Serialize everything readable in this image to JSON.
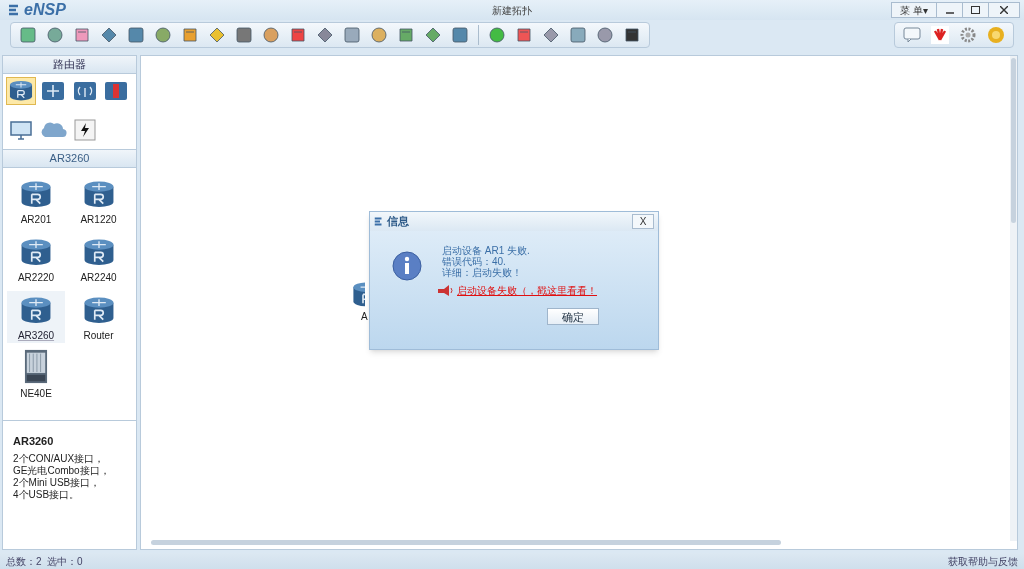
{
  "window": {
    "logo": "eNSP",
    "title": "新建拓扑",
    "menu": "菜 单▾"
  },
  "category_panel": {
    "title": "路由器",
    "categories": [
      {
        "kind": "router",
        "selected": true
      },
      {
        "kind": "switch",
        "selected": false
      },
      {
        "kind": "wireless",
        "selected": false
      },
      {
        "kind": "firewall",
        "selected": false
      },
      {
        "kind": "pc",
        "selected": false
      },
      {
        "kind": "cloud",
        "selected": false
      },
      {
        "kind": "cable",
        "selected": false
      }
    ]
  },
  "device_panel": {
    "title": "AR3260",
    "devices": [
      {
        "label": "AR201",
        "kind": "router",
        "selected": false
      },
      {
        "label": "AR1220",
        "kind": "router",
        "selected": false
      },
      {
        "label": "AR2220",
        "kind": "router",
        "selected": false
      },
      {
        "label": "AR2240",
        "kind": "router",
        "selected": false
      },
      {
        "label": "AR3260",
        "kind": "router",
        "selected": true
      },
      {
        "label": "Router",
        "kind": "router",
        "selected": false
      },
      {
        "label": "NE40E",
        "kind": "chassis",
        "selected": false
      }
    ]
  },
  "description": {
    "title": "AR3260",
    "lines": [
      "2个CON/AUX接口，",
      "GE光电Combo接口，",
      "2个Mini USB接口，",
      "4个USB接口。"
    ]
  },
  "canvas": {
    "nodes": [
      {
        "label": "A"
      }
    ]
  },
  "dialog": {
    "title": "信息",
    "close": "X",
    "lines": [
      "启动设备 AR1 失败.",
      "错误代码：40.",
      "详细：启动失败！"
    ],
    "link": "启动设备失败（，戳这里看看！",
    "button": "确定"
  },
  "status_bar": {
    "stats": "总数：2  选中：0",
    "help": "获取帮助与反馈"
  }
}
